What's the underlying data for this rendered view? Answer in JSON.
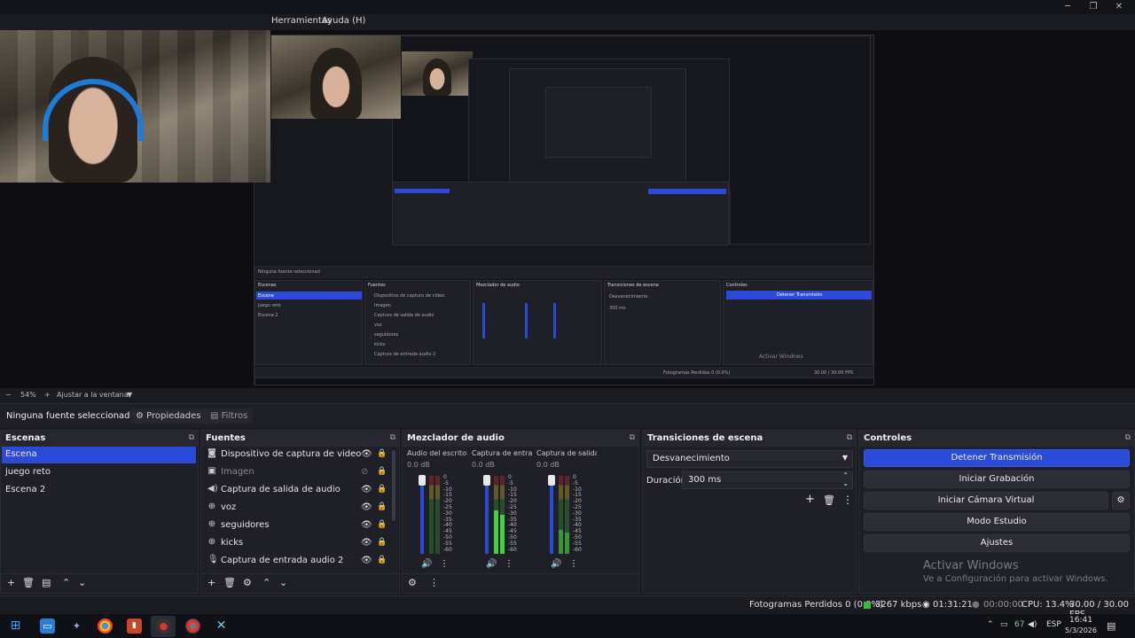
{
  "menubar": {
    "items": [
      "Herramientas",
      "Ayuda (H)"
    ]
  },
  "zoombar": {
    "zoom": "54%",
    "fit": "Ajustar a la ventana"
  },
  "context": {
    "source": "Ninguna fuente seleccionad",
    "properties": "Propiedades",
    "filters": "Filtros"
  },
  "scenes": {
    "title": "Escenas",
    "items": [
      "Escena",
      "juego reto",
      "Escena 2"
    ],
    "selected": 0
  },
  "sources": {
    "title": "Fuentes",
    "items": [
      {
        "icon": "camera-icon",
        "name": "Dispositivo de captura de video",
        "visible": true
      },
      {
        "icon": "image-icon",
        "name": "Imagen",
        "visible": false
      },
      {
        "icon": "speaker-icon",
        "name": "Captura de salida de audio",
        "visible": true
      },
      {
        "icon": "globe-icon",
        "name": "voz",
        "visible": true
      },
      {
        "icon": "globe-icon",
        "name": "seguidores",
        "visible": true
      },
      {
        "icon": "globe-icon",
        "name": "kicks",
        "visible": true
      },
      {
        "icon": "microphone-icon",
        "name": "Captura de entrada audio 2",
        "visible": true
      }
    ]
  },
  "mixer": {
    "title": "Mezclador de audio",
    "channels": [
      {
        "name": "Audio del escritorio",
        "db": "0.0 dB",
        "level": 0.0
      },
      {
        "name": "Captura de entrada",
        "db": "0.0 dB",
        "level": 0.55
      },
      {
        "name": "Captura de salida c",
        "db": "0.0 dB",
        "level": 0.3
      }
    ],
    "scale": [
      "0",
      "-5",
      "-10",
      "-15",
      "-20",
      "-25",
      "-30",
      "-35",
      "-40",
      "-45",
      "-50",
      "-55",
      "-60"
    ]
  },
  "transitions": {
    "title": "Transiciones de escena",
    "type": "Desvanecimiento",
    "duration_label": "Duración",
    "duration": "300 ms"
  },
  "controls": {
    "title": "Controles",
    "stop_stream": "Detener Transmisión",
    "start_recording": "Iniciar Grabación",
    "virtual_cam": "Iniciar Cámara Virtual",
    "studio": "Modo Estudio",
    "settings": "Ajustes"
  },
  "watermark": {
    "title": "Activar Windows",
    "subtitle": "Ve a Configuración para activar Windows."
  },
  "status": {
    "dropped": "Fotogramas Perdidos 0 (0.0%)",
    "bitrate": "3267 kbps",
    "stream_time": "01:31:21",
    "rec_time": "00:00:00",
    "cpu": "CPU: 13.4%",
    "fps": "30.00 / 30.00 FPS"
  },
  "taskbar": {
    "lang": "ESP",
    "battery": "67",
    "time": "16:41",
    "date": "5/3/2026"
  },
  "colors": {
    "accent": "#2c4ad8",
    "panel": "#1f2027",
    "background": "#1b1c22"
  }
}
